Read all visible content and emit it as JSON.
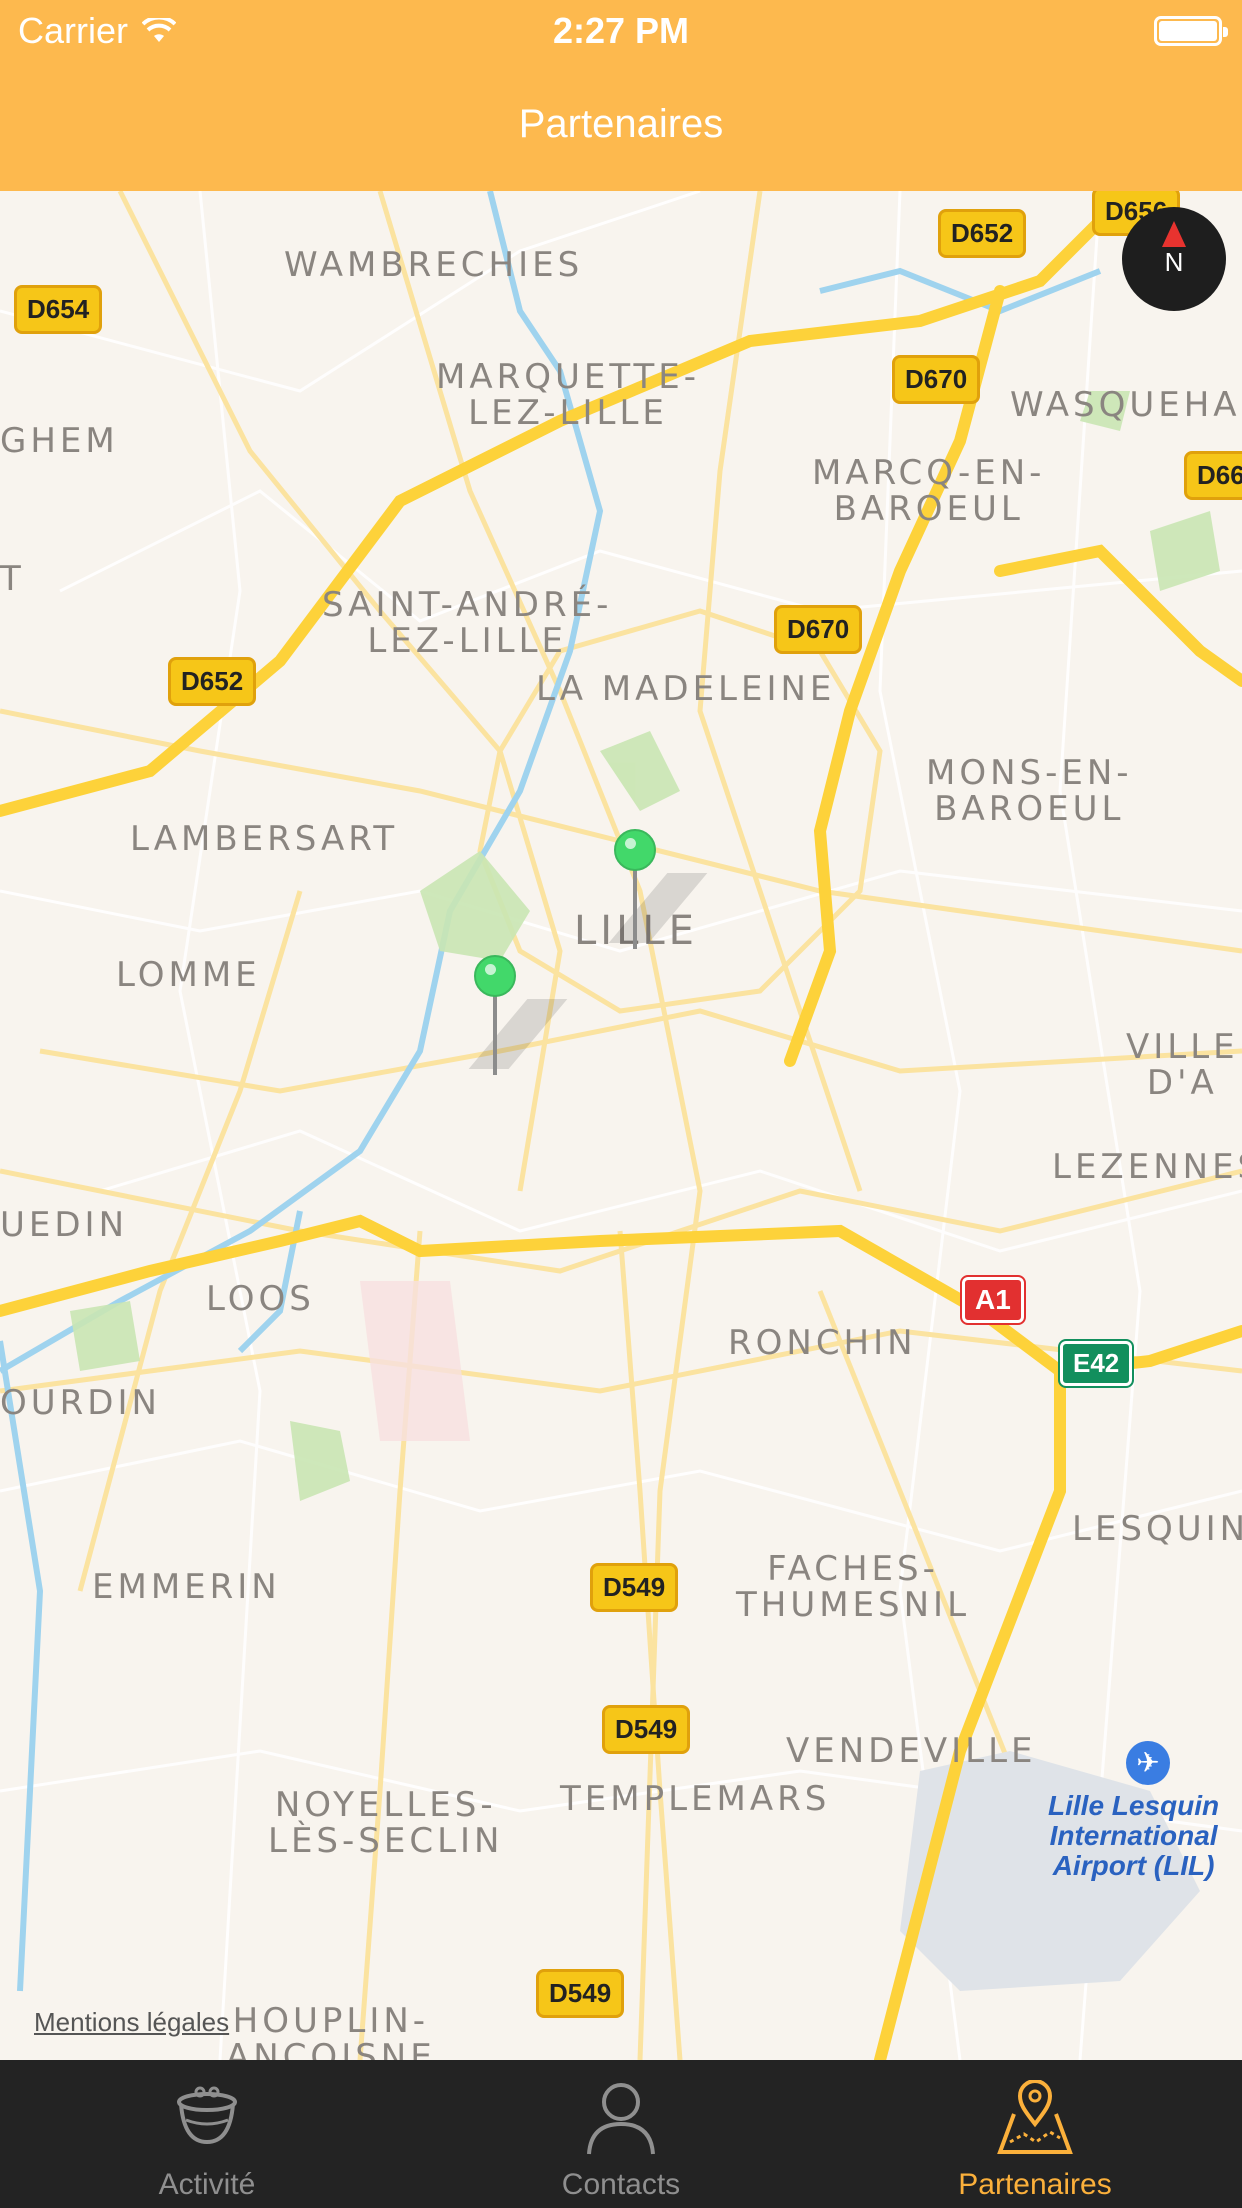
{
  "status_bar": {
    "carrier": "Carrier",
    "time": "2:27 PM"
  },
  "nav": {
    "title": "Partenaires"
  },
  "map": {
    "places": [
      "Wambrechies",
      "Marquette-\nlez-Lille",
      "ghem",
      "t",
      "Marcq-en-\nBaroeul",
      "Wasquehal",
      "Saint-André-\nlez-Lille",
      "La Madeleine",
      "Lambersart",
      "Mons-en-\nBaroeul",
      "Lille",
      "Lomme",
      "Ville\nd'A",
      "Lezennes",
      "uedin",
      "Loos",
      "Ronchin",
      "ourdin",
      "Lesquin",
      "Emmerin",
      "Faches-\nThumesnil",
      "Vendeville",
      "Templemars",
      "Noyelles-\nlès-Seclin",
      "Houplin-\nAncoisne"
    ],
    "road_shields": [
      "D656",
      "D652",
      "D654",
      "D670",
      "D66",
      "D670",
      "D652",
      "D549",
      "D549",
      "D549"
    ],
    "motorway_shields": [
      "A1"
    ],
    "euro_shields": [
      "E42"
    ],
    "airport_label": "Lille Lesquin\nInternational\nAirport (LIL)",
    "compass_letter": "N",
    "legal_link": "Mentions légales",
    "pins": [
      "green",
      "green"
    ]
  },
  "tabs": [
    {
      "label": "Activité",
      "icon": "pot-icon",
      "active": false
    },
    {
      "label": "Contacts",
      "icon": "person-icon",
      "active": false
    },
    {
      "label": "Partenaires",
      "icon": "map-pin-icon",
      "active": true
    }
  ],
  "colors": {
    "accent": "#fdb94e",
    "pin": "#42d86a",
    "tab_active": "#fbb03b",
    "tab_inactive": "#8f8f8f"
  }
}
